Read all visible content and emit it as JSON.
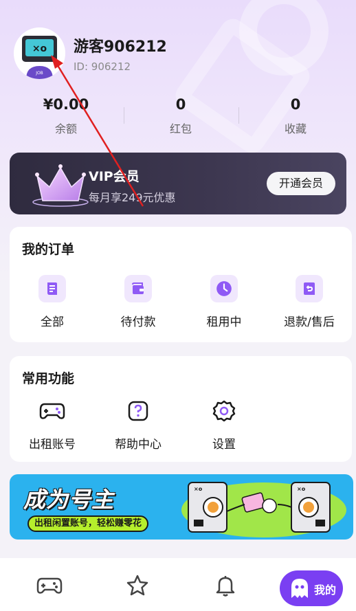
{
  "profile": {
    "username": "游客906212",
    "user_id": "ID: 906212",
    "avatar_screen_text": "×o",
    "avatar_shirt_text": "JOB"
  },
  "stats": [
    {
      "value": "¥0.00",
      "label": "余额"
    },
    {
      "value": "0",
      "label": "红包"
    },
    {
      "value": "0",
      "label": "收藏"
    }
  ],
  "vip": {
    "title": "VIP会员",
    "subtitle": "每月享249元优惠",
    "button": "开通会员"
  },
  "orders": {
    "title": "我的订单",
    "items": [
      {
        "label": "全部",
        "icon": "document-icon"
      },
      {
        "label": "待付款",
        "icon": "wallet-icon"
      },
      {
        "label": "租用中",
        "icon": "clock-icon"
      },
      {
        "label": "退款/售后",
        "icon": "return-icon"
      }
    ]
  },
  "functions": {
    "title": "常用功能",
    "items": [
      {
        "label": "出租账号",
        "icon": "gamepad-icon"
      },
      {
        "label": "帮助中心",
        "icon": "help-icon"
      },
      {
        "label": "设置",
        "icon": "gear-icon"
      }
    ]
  },
  "banner": {
    "title": "成为号主",
    "subtitle": "出租闲置账号，轻松赚零花",
    "art_text": "×o"
  },
  "nav": {
    "items": [
      {
        "icon": "gamepad-icon"
      },
      {
        "icon": "star-icon"
      },
      {
        "icon": "bell-icon"
      }
    ],
    "active_label": "我的",
    "active_icon": "ghost-icon"
  },
  "colors": {
    "accent": "#7a3ff2",
    "icon_bg": "#f0e7fd",
    "vip_bg": "#2f2b3f",
    "banner_bg": "#2bb2ee",
    "arrow": "#e02020"
  }
}
